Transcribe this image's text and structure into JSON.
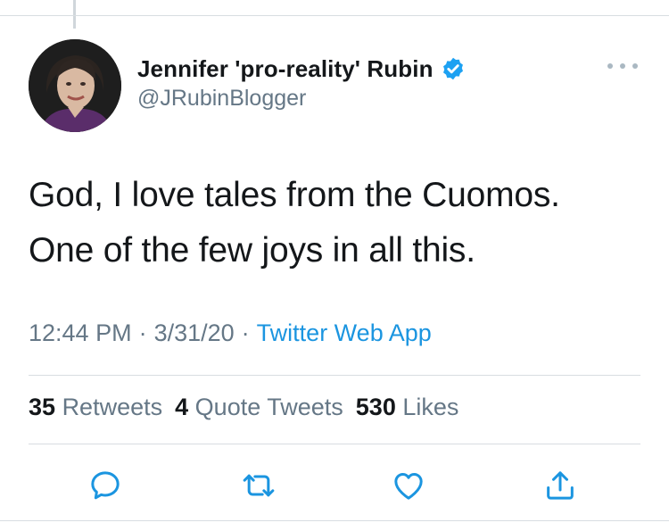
{
  "author": {
    "display_name": "Jennifer 'pro-reality' Rubin",
    "handle": "@JRubinBlogger",
    "verified": true,
    "avatar_icon": "profile-photo"
  },
  "tweet": {
    "lines": [
      "God, I love tales from the Cuomos.",
      "One of the few joys in all this."
    ],
    "time": "12:44 PM",
    "date": "3/31/20",
    "separator": "·",
    "source": "Twitter Web App"
  },
  "stats": {
    "retweets_count": "35",
    "retweets_label": "Retweets",
    "quotes_count": "4",
    "quotes_label": "Quote Tweets",
    "likes_count": "530",
    "likes_label": "Likes"
  },
  "actions": [
    "reply-icon",
    "retweet-icon",
    "like-icon",
    "share-icon"
  ],
  "colors": {
    "text": "#14171a",
    "secondary": "#657786",
    "link": "#1b95e0",
    "verified": "#1da1f2",
    "divider": "#d8dde1"
  }
}
